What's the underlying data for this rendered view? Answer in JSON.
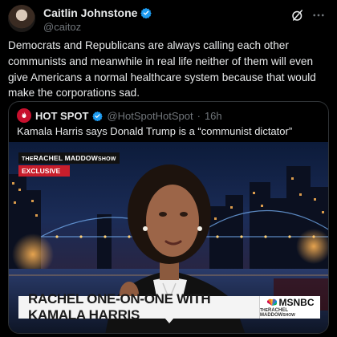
{
  "author": {
    "name": "Caitlin Johnstone",
    "handle": "@caitoz"
  },
  "tweet": {
    "text": "Democrats and Republicans are always calling each other communists and meanwhile in real life neither of them will even give Americans a normal healthcare system because that would make the corporations sad."
  },
  "quote": {
    "name": "HOT SPOT",
    "handle": "@HotSpotHotSpot",
    "separator": "·",
    "time": "16h",
    "text": "Kamala Harris says Donald Trump is a “communist dictator”"
  },
  "video": {
    "logo_prefix": "THE",
    "logo_main": "RACHEL MADDOW",
    "logo_suffix": "SHOW",
    "badge": "EXCLUSIVE",
    "chyron": "RACHEL ONE-ON-ONE WITH KAMALA HARRIS",
    "network": "MSNBC",
    "brand_prefix": "THE",
    "brand_main": "RACHEL MADDOW",
    "brand_suffix": "SHOW"
  },
  "icons": {
    "verified": "verified-badge-icon",
    "grok": "grok-icon",
    "more": "more-icon"
  },
  "colors": {
    "verified": "#1d9bf0",
    "exclusive": "#c81e2c"
  }
}
